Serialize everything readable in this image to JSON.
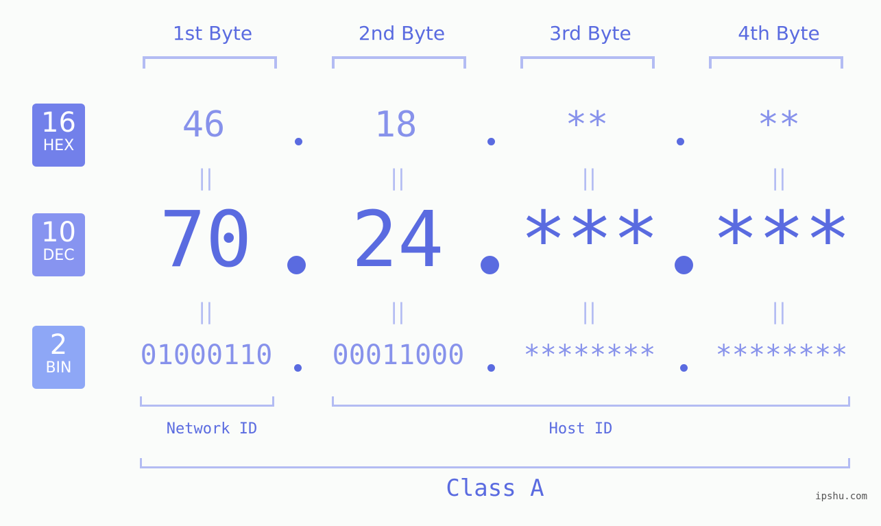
{
  "bytes": [
    {
      "label": "1st Byte",
      "hex": "46",
      "dec": "70",
      "bin": "01000110"
    },
    {
      "label": "2nd Byte",
      "hex": "18",
      "dec": "24",
      "bin": "00011000"
    },
    {
      "label": "3rd Byte",
      "hex": "**",
      "dec": "***",
      "bin": "********"
    },
    {
      "label": "4th Byte",
      "hex": "**",
      "dec": "***",
      "bin": "********"
    }
  ],
  "bases": {
    "hex": {
      "num": "16",
      "label": "HEX",
      "color": "#7280ea"
    },
    "dec": {
      "num": "10",
      "label": "DEC",
      "color": "#8794f0"
    },
    "bin": {
      "num": "2",
      "label": "BIN",
      "color": "#8ea7f6"
    }
  },
  "equals_symbol": "||",
  "network_label": "Network ID",
  "host_label": "Host ID",
  "class_label": "Class A",
  "watermark": "ipshu.com"
}
